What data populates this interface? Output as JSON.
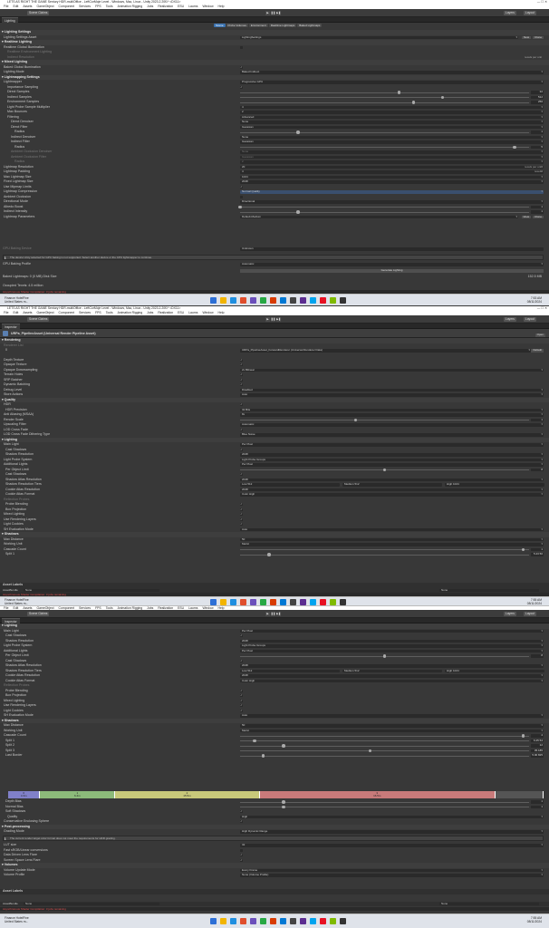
{
  "window_title": "LETS AS RIGHT THE GAME Sentury HDR-multiOffice - LeftCorMoje Level - Windows, Mac, Linux - Unity 2023.2.20f1* <DX11>",
  "window_title_2": "LETS AS RIGHT THE GAME Sentury HDR-multiOffice - LeftCorMoje Level - Windows, Mac, Linux - Unity 2023.2.20f1* <DX11>",
  "menu": [
    "File",
    "Edit",
    "Assets",
    "GameObject",
    "Component",
    "Services",
    "FPS",
    "Tools",
    "Animation Rigging",
    "Jobs",
    "Realization",
    "ESU",
    "Laurns",
    "Window",
    "Help"
  ],
  "toolbar": {
    "account": "Scene Claims",
    "layers": "Layers",
    "layout": "Layout",
    "play": "▶",
    "pause": "❚❚",
    "step": "▶❚"
  },
  "shot1": {
    "tab": "Lighting",
    "subtabs": [
      "Scene",
      "Probe Volumes",
      "Environment",
      "Realtime Lightmaps",
      "Baked Lightmaps"
    ],
    "rows": [
      {
        "t": "hdr",
        "l": "Lighting Settings",
        "i": 2
      },
      {
        "t": "fld",
        "l": "Lighting Settings Asset",
        "v": "LightingSettings",
        "i": 4,
        "b": [
          "New",
          "Clone"
        ]
      },
      {
        "t": "hdr",
        "l": "Realtime Lighting",
        "i": 2
      },
      {
        "t": "chk",
        "l": "Realtime Global Illumination",
        "v": "",
        "i": 4
      },
      {
        "t": "dim",
        "l": "Realtime Environment Lighting",
        "i": 8
      },
      {
        "t": "dim",
        "l": "Indirect Resolution",
        "i": 8,
        "r": "texels per unit"
      },
      {
        "t": "hdr",
        "l": "Mixed Lighting",
        "i": 2
      },
      {
        "t": "chk",
        "l": "Baked Global Illumination",
        "v": "✓",
        "i": 4
      },
      {
        "t": "fld",
        "l": "Lighting Mode",
        "v": "Baked Indirect",
        "i": 4
      },
      {
        "t": "hdr",
        "l": "Lightmapping Settings",
        "i": 2
      },
      {
        "t": "fld",
        "l": "Lightmapper",
        "v": "Progressive GPU",
        "i": 4
      },
      {
        "t": "chk",
        "l": "Importance Sampling",
        "v": "✓",
        "i": 8
      },
      {
        "t": "sld",
        "l": "Direct Samples",
        "v": "32",
        "p": 0.55,
        "i": 8
      },
      {
        "t": "sld",
        "l": "Indirect Samples",
        "v": "512",
        "p": 0.7,
        "i": 8
      },
      {
        "t": "sld",
        "l": "Environment Samples",
        "v": "256",
        "p": 0.6,
        "i": 8
      },
      {
        "t": "fld",
        "l": "Light Probe Sample Multiplier",
        "v": "4",
        "i": 8
      },
      {
        "t": "fld",
        "l": "Max Bounces",
        "v": "2",
        "i": 8
      },
      {
        "t": "fld",
        "l": "Filtering",
        "v": "Advanced",
        "i": 8
      },
      {
        "t": "fld",
        "l": "Direct Denoiser",
        "v": "None",
        "i": 12
      },
      {
        "t": "fld",
        "l": "Direct Filter",
        "v": "Gaussian",
        "i": 12
      },
      {
        "t": "sld",
        "l": "Radius",
        "v": "1",
        "p": 0.2,
        "i": 16
      },
      {
        "t": "fld",
        "l": "Indirect Denoiser",
        "v": "None",
        "i": 12
      },
      {
        "t": "fld",
        "l": "Indirect Filter",
        "v": "Gaussian",
        "i": 12
      },
      {
        "t": "sld",
        "l": "Radius",
        "v": "5",
        "p": 0.95,
        "i": 16
      },
      {
        "t": "dim",
        "l": "Ambient Occlusion Denoiser",
        "v": "None",
        "i": 12
      },
      {
        "t": "dim",
        "l": "Ambient Occlusion Filter",
        "v": "Gaussian",
        "i": 12
      },
      {
        "t": "dim",
        "l": "Radius",
        "v": "2",
        "i": 16
      },
      {
        "t": "fld",
        "l": "Lightmap Resolution",
        "v": "20",
        "i": 4,
        "r": "texels per unit"
      },
      {
        "t": "fld",
        "l": "Lightmap Padding",
        "v": "4",
        "i": 4,
        "r": "texels"
      },
      {
        "t": "fld",
        "l": "Max Lightmap Size",
        "v": "1024",
        "i": 4
      },
      {
        "t": "fld",
        "l": "Fixed Lightmap Size",
        "v": "2048",
        "i": 4
      },
      {
        "t": "chk",
        "l": "Use Mipmap Limits",
        "v": "✓",
        "i": 4
      },
      {
        "t": "hl",
        "l": "Lightmap Compression",
        "v": "Normal Quality",
        "i": 4
      },
      {
        "t": "chk",
        "l": "Ambient Occlusion",
        "v": "",
        "i": 4
      },
      {
        "t": "fld",
        "l": "Directional Mode",
        "v": "Directional",
        "i": 4
      },
      {
        "t": "sld",
        "l": "Albedo Boost",
        "v": "1",
        "p": 0.0,
        "i": 4
      },
      {
        "t": "sld",
        "l": "Indirect Intensity",
        "v": "1",
        "p": 0.2,
        "i": 4
      },
      {
        "t": "fld",
        "l": "Lightmap Parameters",
        "v": "Default-Medium",
        "i": 4,
        "b": [
          "View",
          "Clone"
        ]
      }
    ],
    "gpu_label": "GPU Baking Device",
    "gpu_value": "Unknown",
    "help": "The device Unity selected for GPU baking is not supported. Select another device or the CPU lightmapper to continue.",
    "gpu_profile_label": "GPU Baking Profile",
    "gpu_profile_value": "Automatic",
    "generate_btn": "Generate Lighting",
    "footer1": "Baked Lightmaps: 0 (0 MB) Disk Size",
    "footer1_r": "152.5 MB",
    "footer2": "Occupied Texels: 4.5 million",
    "status": "Asynchronous Shader Compilation: 3 jobs remaining",
    "taskbar_app": "Finance HotelFine",
    "taskbar_sub": "United States m...",
    "time": "7:53 AM",
    "date": "08/11/2024"
  },
  "shot2": {
    "header": "Inspector",
    "asset_title": "URPa_PipelineAsset (Universal Render Pipeline Asset)",
    "open_btn": "Open",
    "rows": [
      {
        "t": "hdr",
        "l": "Rendering",
        "i": 2
      },
      {
        "t": "dim",
        "l": "Renderer List",
        "i": 4
      },
      {
        "t": "fld",
        "l": "0",
        "v": "URPa_PipelineAsset_ForwardRenderer (Universal Renderer Data)",
        "i": 6,
        "b": [
          "Default"
        ]
      },
      {
        "t": "gap"
      },
      {
        "t": "chk",
        "l": "Depth Texture",
        "v": "✓",
        "i": 4
      },
      {
        "t": "chk",
        "l": "Opaque Texture",
        "v": "✓",
        "i": 4
      },
      {
        "t": "fld",
        "l": "Opaque Downsampling",
        "v": "2x Bilinear",
        "i": 4
      },
      {
        "t": "chk",
        "l": "Terrain Holes",
        "v": "✓",
        "i": 4
      },
      {
        "t": "chk",
        "l": "SRP Batcher",
        "v": "✓",
        "i": 4
      },
      {
        "t": "chk",
        "l": "Dynamic Batching",
        "v": "✓",
        "i": 4
      },
      {
        "t": "fld",
        "l": "Debug Level",
        "v": "Disabled",
        "i": 4
      },
      {
        "t": "fld",
        "l": "Store Actions",
        "v": "Auto",
        "i": 4
      },
      {
        "t": "hdr",
        "l": "Quality",
        "i": 2
      },
      {
        "t": "chk",
        "l": "HDR",
        "v": "✓",
        "i": 4
      },
      {
        "t": "fld",
        "l": "HDR Precision",
        "v": "32 Bits",
        "i": 6
      },
      {
        "t": "fld",
        "l": "Anti Aliasing (MSAA)",
        "v": "8x",
        "i": 4
      },
      {
        "t": "sld",
        "l": "Render Scale",
        "v": "1",
        "p": 0.4,
        "i": 4
      },
      {
        "t": "fld",
        "l": "Upscaling Filter",
        "v": "Automatic",
        "i": 4
      },
      {
        "t": "chk",
        "l": "LOD Cross Fade",
        "v": "✓",
        "i": 4
      },
      {
        "t": "fld",
        "l": "LOD Cross Fade Dithering Type",
        "v": "Blue Noise",
        "i": 4
      },
      {
        "t": "hdr",
        "l": "Lighting",
        "i": 2
      },
      {
        "t": "fld",
        "l": "Main Light",
        "v": "Per Pixel",
        "i": 4
      },
      {
        "t": "chk",
        "l": "Cast Shadows",
        "v": "✓",
        "i": 6
      },
      {
        "t": "fld",
        "l": "Shadow Resolution",
        "v": "2048",
        "i": 6
      },
      {
        "t": "fld",
        "l": "Light Probe System",
        "v": "Light Probe Groups",
        "i": 4
      },
      {
        "t": "fld",
        "l": "Additional Lights",
        "v": "Per Pixel",
        "i": 4
      },
      {
        "t": "sld",
        "l": "Per Object Limit",
        "v": "8",
        "p": 0.5,
        "i": 6
      },
      {
        "t": "chk",
        "l": "Cast Shadows",
        "v": "✓",
        "i": 6
      },
      {
        "t": "fld",
        "l": "Shadow Atlas Resolution",
        "v": "2048",
        "i": 6
      },
      {
        "t": "tri",
        "l": "Shadow Resolution Tiers",
        "v": [
          "Low 512",
          "Medium 512",
          "High 1024"
        ],
        "i": 6
      },
      {
        "t": "fld",
        "l": "Cookie Atlas Resolution",
        "v": "2048",
        "i": 6
      },
      {
        "t": "fld",
        "l": "Cookie Atlas Format",
        "v": "Color High",
        "i": 6
      },
      {
        "t": "dim",
        "l": "Reflection Probes",
        "i": 4
      },
      {
        "t": "chk",
        "l": "Probe Blending",
        "v": "✓",
        "i": 6
      },
      {
        "t": "chk",
        "l": "Box Projection",
        "v": "✓",
        "i": 6
      },
      {
        "t": "chk",
        "l": "Mixed Lighting",
        "v": "✓",
        "i": 4
      },
      {
        "t": "chk",
        "l": "Use Rendering Layers",
        "v": "✓",
        "i": 4
      },
      {
        "t": "chk",
        "l": "Light Cookies",
        "v": "✓",
        "i": 4
      },
      {
        "t": "fld",
        "l": "SH Evaluation Mode",
        "v": "Auto",
        "i": 4
      },
      {
        "t": "hdr",
        "l": "Shadows",
        "i": 2
      },
      {
        "t": "fld",
        "l": "Max Distance",
        "v": "50",
        "i": 4
      },
      {
        "t": "fld",
        "l": "Working Unit",
        "v": "Metric",
        "i": 4
      },
      {
        "t": "sld",
        "l": "Cascade Count",
        "v": "1",
        "p": 0.98,
        "i": 4
      },
      {
        "t": "sld",
        "l": "Split 1",
        "v": "5.23 50",
        "p": 0.1,
        "i": 6
      }
    ],
    "asset_labels": "Asset Labels",
    "assetbundle": "AssetBundle",
    "none1": "None",
    "none2": "None",
    "status": "Asynchronous Shader Compilation: 3 jobs remaining",
    "taskbar_app": "Finance HotelFine",
    "taskbar_sub": "United States m...",
    "time": "7:55 AM",
    "date": "08/11/2024"
  },
  "shot3": {
    "header": "Inspector",
    "rows": [
      {
        "t": "hdr",
        "l": "Lighting",
        "i": 2
      },
      {
        "t": "fld",
        "l": "Main Light",
        "v": "Per Pixel",
        "i": 4
      },
      {
        "t": "chk",
        "l": "Cast Shadows",
        "v": "✓",
        "i": 6
      },
      {
        "t": "fld",
        "l": "Shadow Resolution",
        "v": "2048",
        "i": 6
      },
      {
        "t": "fld",
        "l": "Light Probe System",
        "v": "Light Probe Groups",
        "i": 4
      },
      {
        "t": "fld",
        "l": "Additional Lights",
        "v": "Per Pixel",
        "i": 4
      },
      {
        "t": "sld",
        "l": "Per Object Limit",
        "v": "8",
        "p": 0.5,
        "i": 6
      },
      {
        "t": "chk",
        "l": "Cast Shadows",
        "v": "✓",
        "i": 6
      },
      {
        "t": "fld",
        "l": "Shadow Atlas Resolution",
        "v": "2048",
        "i": 6
      },
      {
        "t": "tri",
        "l": "Shadow Resolution Tiers",
        "v": [
          "Low 512",
          "Medium 512",
          "High 1024"
        ],
        "i": 6
      },
      {
        "t": "fld",
        "l": "Cookie Atlas Resolution",
        "v": "2048",
        "i": 6
      },
      {
        "t": "fld",
        "l": "Cookie Atlas Format",
        "v": "Color High",
        "i": 6
      },
      {
        "t": "dim",
        "l": "Reflection Probes",
        "i": 4
      },
      {
        "t": "chk",
        "l": "Probe Blending",
        "v": "✓",
        "i": 6
      },
      {
        "t": "chk",
        "l": "Box Projection",
        "v": "✓",
        "i": 6
      },
      {
        "t": "chk",
        "l": "Mixed Lighting",
        "v": "✓",
        "i": 4
      },
      {
        "t": "chk",
        "l": "Use Rendering Layers",
        "v": "✓",
        "i": 4
      },
      {
        "t": "chk",
        "l": "Light Cookies",
        "v": "✓",
        "i": 4
      },
      {
        "t": "fld",
        "l": "SH Evaluation Mode",
        "v": "Auto",
        "i": 4
      },
      {
        "t": "hdr",
        "l": "Shadows",
        "i": 2
      },
      {
        "t": "fld",
        "l": "Max Distance",
        "v": "50",
        "i": 4
      },
      {
        "t": "fld",
        "l": "Working Unit",
        "v": "Metric",
        "i": 4
      },
      {
        "t": "sld",
        "l": "Cascade Count",
        "v": "4",
        "p": 0.98,
        "i": 4
      },
      {
        "t": "sld",
        "l": "Split 1",
        "v": "6.25 54",
        "p": 0.05,
        "i": 6
      },
      {
        "t": "sld",
        "l": "Split 2",
        "v": "12",
        "p": 0.15,
        "i": 6
      },
      {
        "t": "sld",
        "l": "Split 3",
        "v": "35.185",
        "p": 0.45,
        "i": 6
      },
      {
        "t": "sld",
        "l": "Last Border",
        "v": "5.00 825",
        "p": 0.08,
        "i": 6
      }
    ],
    "cascades": [
      {
        "label": "0\n4.3m",
        "w": 0.06,
        "c": "#8080c8"
      },
      {
        "label": "1\n6.4m",
        "w": 0.14,
        "c": "#8cba7a"
      },
      {
        "label": "2\n15.5m",
        "w": 0.27,
        "c": "#c8c87a"
      },
      {
        "label": "3\n16.5m",
        "w": 0.44,
        "c": "#c87a7a"
      },
      {
        "label": "",
        "w": 0.09,
        "c": "#555"
      }
    ],
    "rows2": [
      {
        "t": "sld",
        "l": "Depth Bias",
        "v": "1",
        "p": 0.15,
        "i": 6
      },
      {
        "t": "sld",
        "l": "Normal Bias",
        "v": "1",
        "p": 0.15,
        "i": 6
      },
      {
        "t": "chk",
        "l": "Soft Shadows",
        "v": "✓",
        "i": 6
      },
      {
        "t": "fld",
        "l": "Quality",
        "v": "High",
        "i": 8
      },
      {
        "t": "chk",
        "l": "Conservative Enclosing Sphere",
        "v": "✓",
        "i": 4
      },
      {
        "t": "hdr",
        "l": "Post-processing",
        "i": 2
      },
      {
        "t": "fld",
        "l": "Grading Mode",
        "v": "High Dynamic Range",
        "i": 4
      }
    ],
    "help": "The current render target color format does not meet the requirements for HDR grading.",
    "rows3": [
      {
        "t": "fld",
        "l": "LUT size",
        "v": "32",
        "i": 4
      },
      {
        "t": "chk",
        "l": "Fast sRGB/Linear conversions",
        "v": "",
        "i": 4
      },
      {
        "t": "chk",
        "l": "Data Driven Lens Flare",
        "v": "✓",
        "i": 4
      },
      {
        "t": "chk",
        "l": "Screen Space Lens Flare",
        "v": "✓",
        "i": 4
      },
      {
        "t": "hdr",
        "l": "Volumes",
        "i": 2
      },
      {
        "t": "fld",
        "l": "Volume Update Mode",
        "v": "Every Frame",
        "i": 4
      },
      {
        "t": "fld",
        "l": "Volume Profile",
        "v": "None (Volume Profile)",
        "i": 4
      }
    ],
    "asset_labels": "Asset Labels",
    "assetbundle": "AssetBundle",
    "none1": "None",
    "none2": "None",
    "status": "Asynchronous Shader Compilation: 3 jobs remaining",
    "taskbar_app": "Finance HotelFine",
    "taskbar_sub": "United States m...",
    "time": "7:55 AM",
    "date": "08/11/2024"
  },
  "colors": {
    "accent": "#3a72b0",
    "panel": "#383838",
    "field": "#2a2a2a",
    "error": "#e05050"
  }
}
